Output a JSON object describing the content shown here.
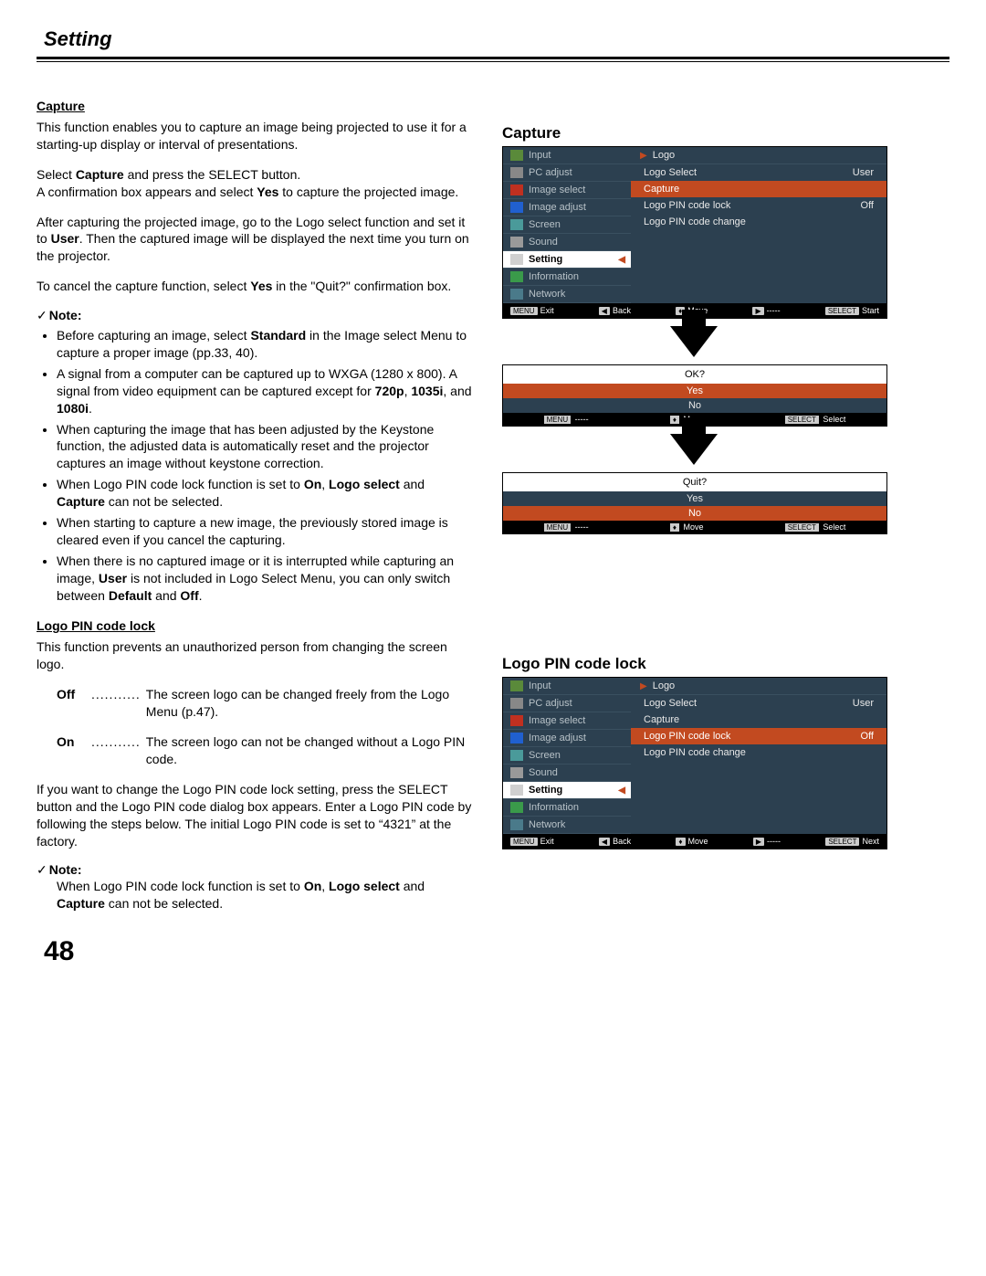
{
  "header": {
    "title": "Setting"
  },
  "pageNumber": "48",
  "leftCol": {
    "capture": {
      "heading": "Capture",
      "p1": "This function enables you to capture an image being projected to use it for a starting-up display or interval of presentations.",
      "p2a": "Select ",
      "p2b": "Capture",
      "p2c": " and press the SELECT button.",
      "p3a": "A confirmation box appears and select ",
      "p3b": "Yes",
      "p3c": " to capture the projected image.",
      "p4a": "After capturing the projected image, go to the Logo select function and set it to ",
      "p4b": "User",
      "p4c": ". Then the captured image will be displayed the next time you turn on the projector.",
      "p5a": "To cancel the capture function, select ",
      "p5b": "Yes",
      "p5c": " in the \"Quit?\" confirmation box.",
      "noteHead": "Note:",
      "bullets": [
        {
          "pre": "Before capturing an image, select ",
          "b1": "Standard",
          "post": " in the Image select Menu to capture a proper image (pp.33, 40)."
        },
        {
          "pre": "A signal from a computer can be captured up to WXGA (1280 x 800). A signal from video equipment can be captured except for ",
          "b1": "720p",
          "mid1": ", ",
          "b2": "1035i",
          "mid2": ", and ",
          "b3": "1080i",
          "post": "."
        },
        {
          "text": "When capturing the image that has been adjusted by the Keystone function, the adjusted data is automatically reset and the projector captures an image without keystone correction."
        },
        {
          "pre": "When Logo PIN code lock function is set to ",
          "b1": "On",
          "mid1": ", ",
          "b2": "Logo select",
          "mid2": " and ",
          "b3": "Capture",
          "post": " can not be selected."
        },
        {
          "text": "When starting to capture a new image, the previously stored image is cleared even if you cancel the capturing."
        },
        {
          "pre": "When there is no captured image or it is interrupted while capturing an image, ",
          "b1": "User",
          "mid1": " is not included in Logo Select Menu, you can only switch between ",
          "b2": "Default",
          "mid2": " and ",
          "b3": "Off",
          "post": "."
        }
      ]
    },
    "pinLock": {
      "heading": "Logo PIN code lock",
      "p1": "This function prevents an unauthorized person from changing the screen logo.",
      "off": {
        "term": "Off",
        "text": "The screen logo can be changed freely from the Logo Menu (p.47)."
      },
      "on": {
        "term": "On",
        "text": "The screen logo can not be changed without a Logo PIN code."
      },
      "p2": "If you want to change the Logo PIN code lock setting, press the SELECT button and the Logo PIN code dialog box appears. Enter a Logo PIN code by following the steps below. The initial Logo PIN code is set to “4321” at the factory.",
      "noteHead": "Note:",
      "note_a": "When Logo PIN code lock function is set to ",
      "note_b1": "On",
      "note_mid1": ", ",
      "note_b2": "Logo select",
      "note_mid2": " and ",
      "note_b3": "Capture",
      "note_post": " can not be selected."
    }
  },
  "rightCol": {
    "captureHead": "Capture",
    "pinHead": "Logo PIN code lock",
    "sidebar": [
      {
        "label": "Input",
        "icon": "ic-green"
      },
      {
        "label": "PC adjust",
        "icon": "ic-grey"
      },
      {
        "label": "Image select",
        "icon": "ic-red"
      },
      {
        "label": "Image adjust",
        "icon": "ic-blue"
      },
      {
        "label": "Screen",
        "icon": "ic-cyan"
      },
      {
        "label": "Sound",
        "icon": "ic-grey2"
      },
      {
        "label": "Setting",
        "icon": "ic-wrench",
        "selected": true
      },
      {
        "label": "Information",
        "icon": "ic-info"
      },
      {
        "label": "Network",
        "icon": "ic-net"
      }
    ],
    "panel1": {
      "head": "Logo",
      "rows": [
        {
          "l": "Logo Select",
          "r": "User"
        },
        {
          "l": "Capture",
          "r": "",
          "hi": true
        },
        {
          "l": "Logo PIN code lock",
          "r": "Off"
        },
        {
          "l": "Logo PIN code change",
          "r": ""
        }
      ]
    },
    "status1": [
      {
        "tag": "MENU",
        "t": "Exit"
      },
      {
        "tag": "◀",
        "t": "Back"
      },
      {
        "tag": "♦",
        "t": "Move"
      },
      {
        "tag": "▶",
        "t": "-----"
      },
      {
        "tag": "SELECT",
        "t": "Start"
      }
    ],
    "dialog1": {
      "title": "OK?",
      "opts": [
        {
          "t": "Yes",
          "hi": true
        },
        {
          "t": "No"
        }
      ],
      "status": [
        {
          "tag": "MENU",
          "t": "-----"
        },
        {
          "tag": "♦",
          "t": "Move"
        },
        {
          "tag": "SELECT",
          "t": "Select"
        }
      ]
    },
    "dialog2": {
      "title": "Quit?",
      "opts": [
        {
          "t": "Yes"
        },
        {
          "t": "No",
          "hi": true
        }
      ],
      "status": [
        {
          "tag": "MENU",
          "t": "-----"
        },
        {
          "tag": "♦",
          "t": "Move"
        },
        {
          "tag": "SELECT",
          "t": "Select"
        }
      ]
    },
    "panel2": {
      "head": "Logo",
      "rows": [
        {
          "l": "Logo Select",
          "r": "User"
        },
        {
          "l": "Capture",
          "r": ""
        },
        {
          "l": "Logo PIN code lock",
          "r": "Off",
          "hi": true
        },
        {
          "l": "Logo PIN code change",
          "r": ""
        }
      ]
    },
    "status2": [
      {
        "tag": "MENU",
        "t": "Exit"
      },
      {
        "tag": "◀",
        "t": "Back"
      },
      {
        "tag": "♦",
        "t": "Move"
      },
      {
        "tag": "▶",
        "t": "-----"
      },
      {
        "tag": "SELECT",
        "t": "Next"
      }
    ]
  }
}
